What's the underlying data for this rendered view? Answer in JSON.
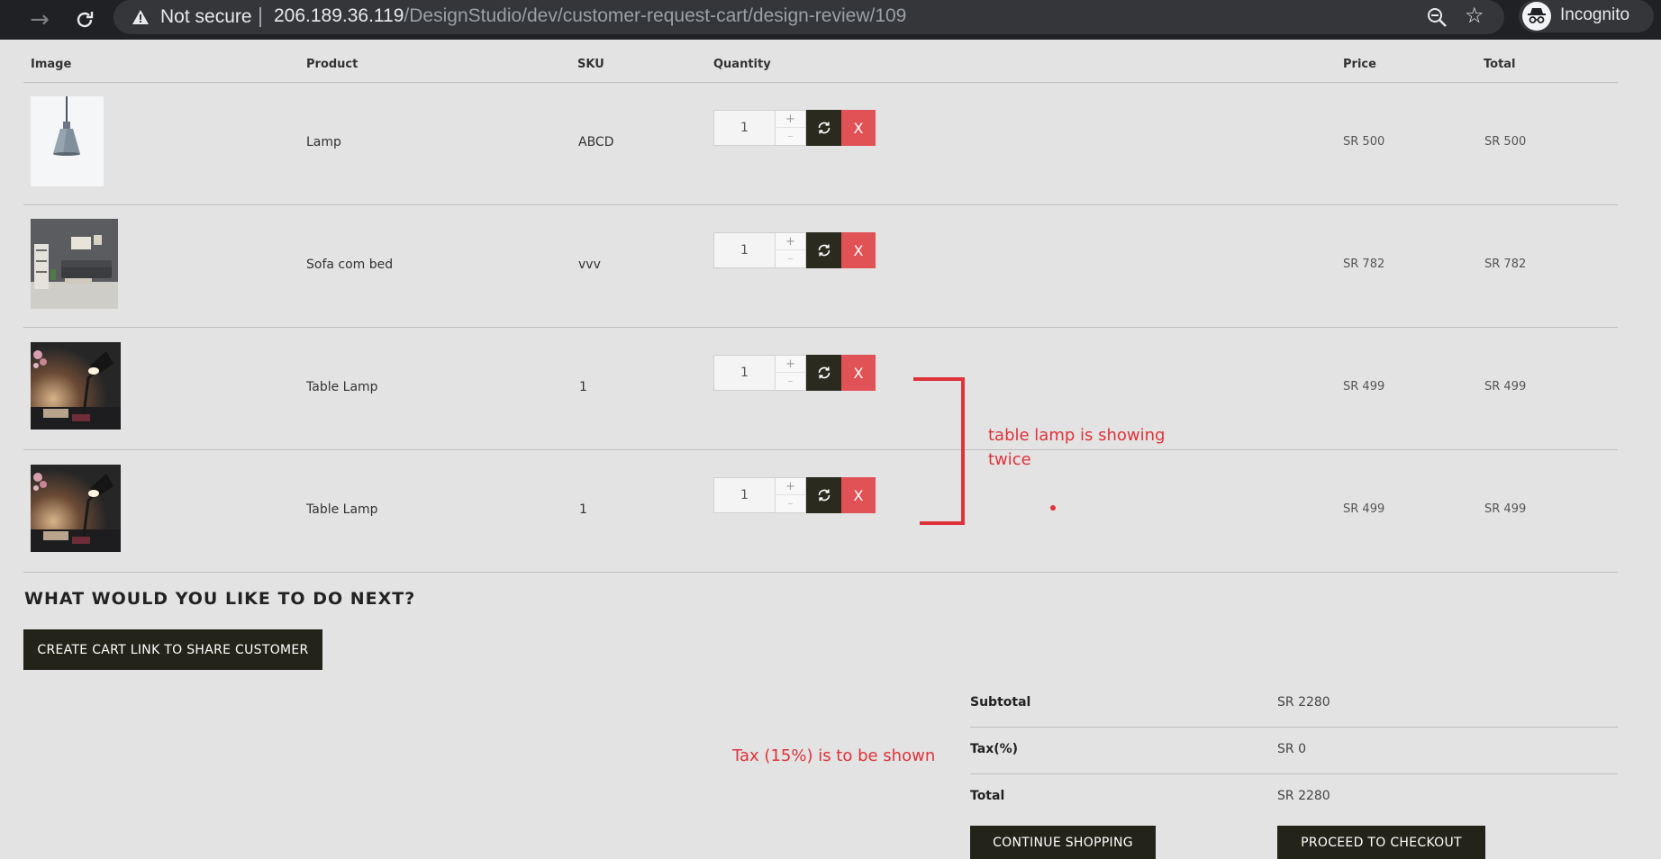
{
  "browser": {
    "security_label": "Not secure",
    "url_host": "206.189.36.119",
    "url_path": "/DesignStudio/dev/customer-request-cart/design-review/109",
    "profile_label": "Incognito"
  },
  "cart": {
    "headers": {
      "image": "Image",
      "product": "Product",
      "sku": "SKU",
      "quantity": "Quantity",
      "price": "Price",
      "total": "Total"
    },
    "rows": [
      {
        "product": "Lamp",
        "sku": "ABCD",
        "quantity": "1",
        "price": "SR 500",
        "total": "SR 500",
        "image": "pendant-lamp"
      },
      {
        "product": "Sofa com bed",
        "sku": "vvv",
        "quantity": "1",
        "price": "SR 782",
        "total": "SR 782",
        "image": "living-room-sofa"
      },
      {
        "product": "Table Lamp",
        "sku": "1",
        "quantity": "1",
        "price": "SR 499",
        "total": "SR 499",
        "image": "desk-lamp"
      },
      {
        "product": "Table Lamp",
        "sku": "1",
        "quantity": "1",
        "price": "SR 499",
        "total": "SR 499",
        "image": "desk-lamp"
      }
    ],
    "qty_plus": "+",
    "qty_minus": "–",
    "remove_label": "X"
  },
  "next": {
    "title": "WHAT WOULD YOU LIKE TO DO NEXT?",
    "share_button": "CREATE CART LINK TO SHARE CUSTOMER"
  },
  "totals": {
    "subtotal_label": "Subtotal",
    "subtotal_value": "SR 2280",
    "tax_label": "Tax(%)",
    "tax_value": "SR 0",
    "total_label": "Total",
    "total_value": "SR 2280",
    "continue_button": "CONTINUE SHOPPING",
    "checkout_button": "PROCEED TO CHECKOUT"
  },
  "annotations": {
    "duplicate_note_line1": "table lamp is showing",
    "duplicate_note_line2": "twice",
    "tax_note": "Tax (15%) is to be shown",
    "color": "#e0323a"
  },
  "colors": {
    "page_bg": "#e3e3e3",
    "dark_button": "#242319",
    "remove_button": "#e05255",
    "browser_chrome": "#202124"
  }
}
